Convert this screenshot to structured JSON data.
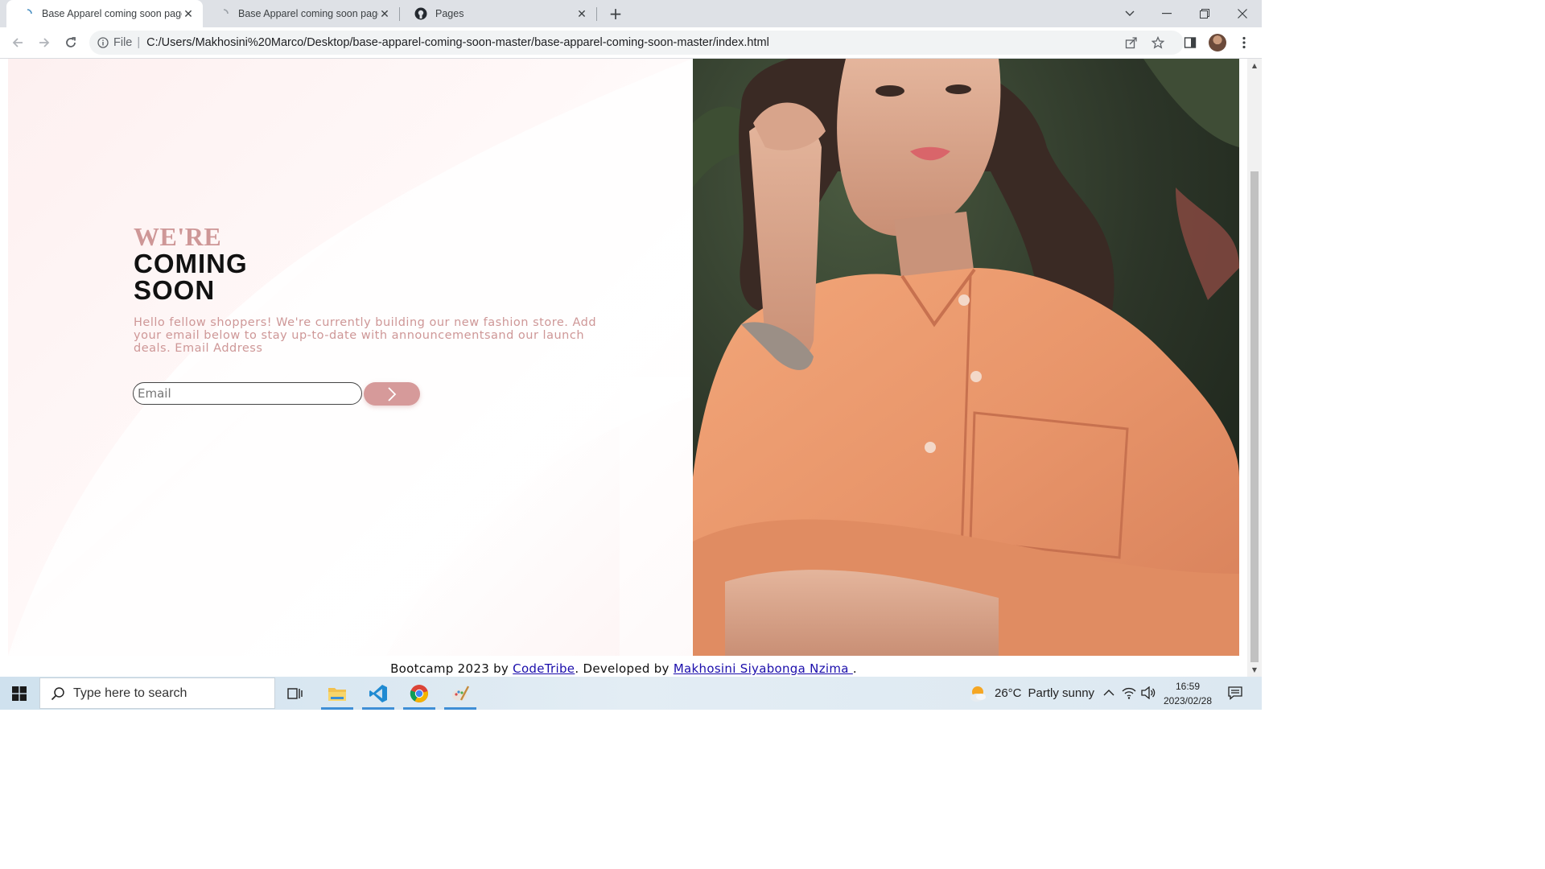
{
  "browser": {
    "tabs": [
      {
        "title": "Base Apparel coming soon page",
        "active": true,
        "favicon": "loading-spinner-icon"
      },
      {
        "title": "Base Apparel coming soon page",
        "active": false,
        "favicon": "loading-spinner-icon"
      },
      {
        "title": "Pages",
        "active": false,
        "favicon": "github-icon"
      }
    ],
    "address": {
      "scheme_label": "File",
      "url": "C:/Users/Makhosini%20Marco/Desktop/base-apparel-coming-soon-master/base-apparel-coming-soon-master/index.html"
    }
  },
  "page": {
    "heading": {
      "line1": "WE'RE",
      "line2": "COMING",
      "line3": "SOON"
    },
    "description": "Hello fellow shoppers! We're currently building our new fashion store. Add your email below to stay up-to-date with announcementsand our launch deals. Email Address",
    "email_placeholder": "Email",
    "footer": {
      "prefix": "Bootcamp 2023 by ",
      "link1": "CodeTribe",
      "middle": ". Developed by ",
      "link2": "Makhosini Siyabonga Nzima ",
      "suffix": "."
    },
    "colors": {
      "accent": "#ce9797",
      "button": "#d69a9a",
      "heading_dark": "#111111"
    }
  },
  "taskbar": {
    "search_placeholder": "Type here to search",
    "weather": {
      "temp": "26°C",
      "condition": "Partly sunny"
    },
    "clock": {
      "time": "16:59",
      "date": "2023/02/28"
    }
  }
}
